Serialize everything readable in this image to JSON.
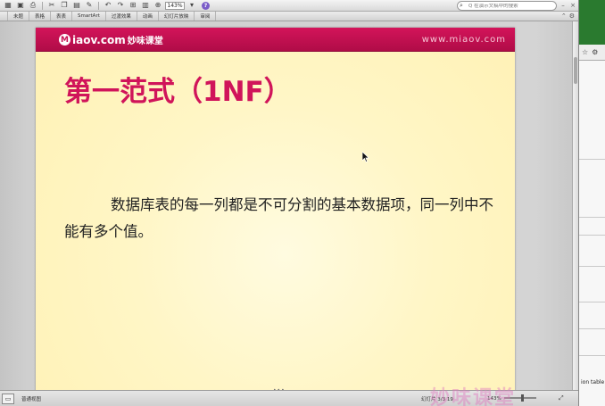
{
  "toolbar": {
    "zoom": "143%",
    "search_placeholder": "Q 在演示文稿中的搜索",
    "icons": [
      "sidebar-icon",
      "save-icon",
      "print-icon",
      "cut-icon",
      "copy-icon",
      "paste-icon",
      "format-icon",
      "undo-icon",
      "redo-icon",
      "table-icon",
      "chart-icon",
      "zoom-icon",
      "help-icon"
    ]
  },
  "tabs": [
    "",
    "未题",
    "表格",
    "表表",
    "SmartArt",
    "过渡效果",
    "动画",
    "幻灯片放映",
    "审阅"
  ],
  "slide": {
    "logo_text": "iaov.com",
    "logo_cn": "妙味课堂",
    "url": "www.miaov.com",
    "title": "第一范式（1NF）",
    "body": "数据库表的每一列都是不可分割的基本数据项，同一列中不能有多个值。"
  },
  "status": {
    "mode": "普通视图",
    "slide": "幻灯片 3/3 19",
    "zoom": "143%"
  },
  "watermark": "妙味课堂",
  "side_window": {
    "partial_text": "ion table"
  },
  "colors": {
    "brand": "#c71152",
    "title": "#d0145a",
    "slide_bg": "#fff6c6"
  }
}
